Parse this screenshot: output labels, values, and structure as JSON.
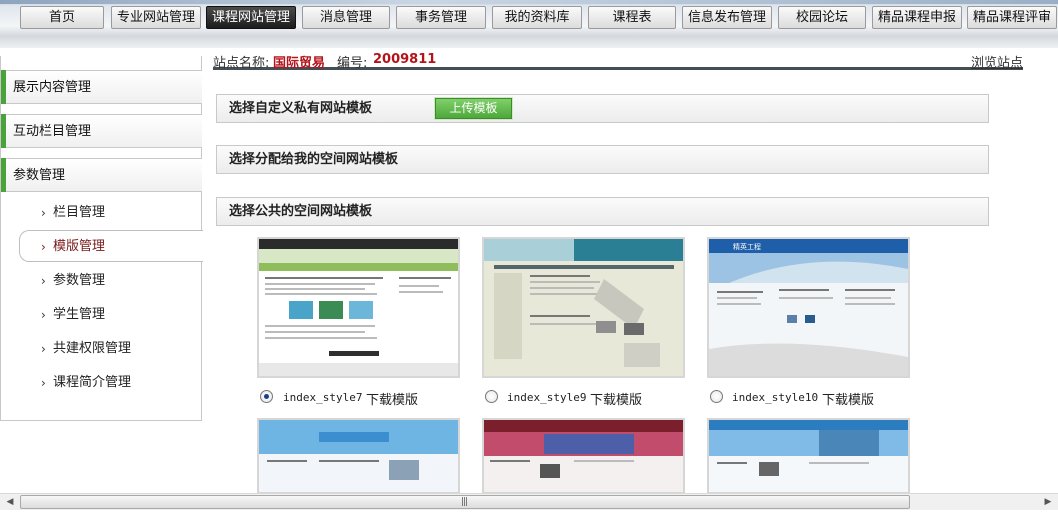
{
  "nav": {
    "items": [
      "首页",
      "专业网站管理",
      "课程网站管理",
      "消息管理",
      "事务管理",
      "我的资料库",
      "课程表",
      "信息发布管理",
      "校园论坛",
      "精品课程申报",
      "精品课程评审"
    ],
    "active_index": 2
  },
  "sidebar": {
    "sections": [
      "展示内容管理",
      "互动栏目管理",
      "参数管理"
    ],
    "items": [
      "栏目管理",
      "模版管理",
      "参数管理",
      "学生管理",
      "共建权限管理",
      "课程简介管理"
    ],
    "active_item": "模版管理"
  },
  "site": {
    "name_label": "站点名称:",
    "name_value": "国际贸易",
    "id_label": "编号:",
    "id_value": "2009811",
    "browse_link": "浏览站点"
  },
  "panels": {
    "custom": "选择自定义私有网站模板",
    "upload_button": "上传模板",
    "assigned": "选择分配给我的空间网站模板",
    "public": "选择公共的空间网站模板"
  },
  "templates": [
    {
      "name": "index_style7",
      "download": "下载模版",
      "selected": true
    },
    {
      "name": "index_style9",
      "download": "下载模版",
      "selected": false
    },
    {
      "name": "index_style10",
      "download": "下载模版",
      "selected": false
    }
  ],
  "thumb_text": {
    "t3_title": "精英工程"
  },
  "colors": {
    "accent_green": "#4aa33a",
    "brand_red": "#b4131a",
    "active_nav": "#2a2a2a"
  }
}
